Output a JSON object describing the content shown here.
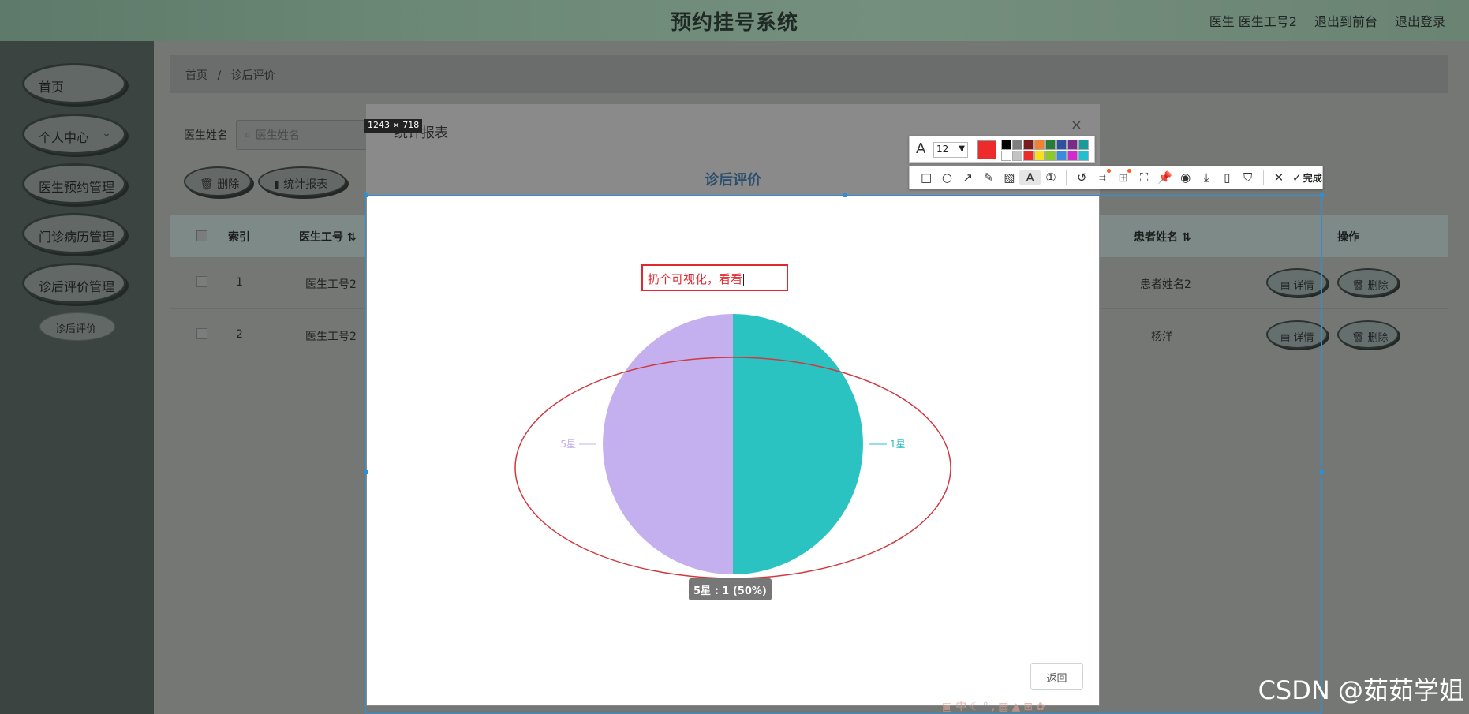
{
  "header": {
    "title": "预约挂号系统",
    "user_label": "医生 医生工号2",
    "front_link": "退出到前台",
    "logout_link": "退出登录"
  },
  "sidebar": {
    "items": [
      {
        "label": "首页"
      },
      {
        "label": "个人中心",
        "expandable": true
      },
      {
        "label": "医生预约管理"
      },
      {
        "label": "门诊病历管理"
      },
      {
        "label": "诊后评价管理"
      }
    ],
    "sub_item": "诊后评价"
  },
  "breadcrumb": {
    "home": "首页",
    "separator": "/",
    "current": "诊后评价"
  },
  "search": {
    "label": "医生姓名",
    "placeholder": "医生姓名"
  },
  "actions": {
    "delete": "删除",
    "stats": "统计报表"
  },
  "table": {
    "columns": [
      "索引",
      "医生工号",
      "患者姓名",
      "操作"
    ],
    "rows": [
      {
        "index": "1",
        "doctor_id": "医生工号2",
        "patient": "患者姓名2",
        "detail": "详情",
        "delete": "删除"
      },
      {
        "index": "2",
        "doctor_id": "医生工号2",
        "patient": "杨洋",
        "detail": "详情",
        "delete": "删除"
      }
    ]
  },
  "modal": {
    "title": "统计报表",
    "close": "×",
    "subtitle": "诊后评价",
    "return_button": "返回"
  },
  "capture_tool": {
    "size_label": "1243 × 718",
    "font_size": "12",
    "current_color": "#ee2b2b",
    "swatches": [
      "#000000",
      "#7f7f7f",
      "#7a1a1a",
      "#f08032",
      "#2a7a3a",
      "#2f4f9f",
      "#7a2a8a",
      "#1a9a9a",
      "#ffffff",
      "#c3c3c3",
      "#ee2b2b",
      "#f5e020",
      "#8acb2a",
      "#3a8ae0",
      "#d02ad0",
      "#20c0d0"
    ],
    "tools": [
      "rect-icon",
      "ellipse-icon",
      "arrow-icon",
      "pen-icon",
      "mosaic-icon",
      "text-icon",
      "number-icon",
      "undo-icon",
      "ocr-icon",
      "translate-icon",
      "scroll-capture-icon",
      "pin-icon",
      "record-icon",
      "download-icon",
      "phone-icon",
      "bookmark-icon"
    ],
    "done_label": "完成",
    "annotation_text": "扔个可视化，看看"
  },
  "chart_data": {
    "type": "pie",
    "title": "",
    "slices": [
      {
        "label": "1星",
        "value": 1,
        "color": "#2bc2c2"
      },
      {
        "label": "5星",
        "value": 1,
        "color": "#c4b0ef"
      }
    ],
    "tooltip": "5星 : 1 (50%)"
  },
  "watermark": "CSDN @茹茹学姐"
}
